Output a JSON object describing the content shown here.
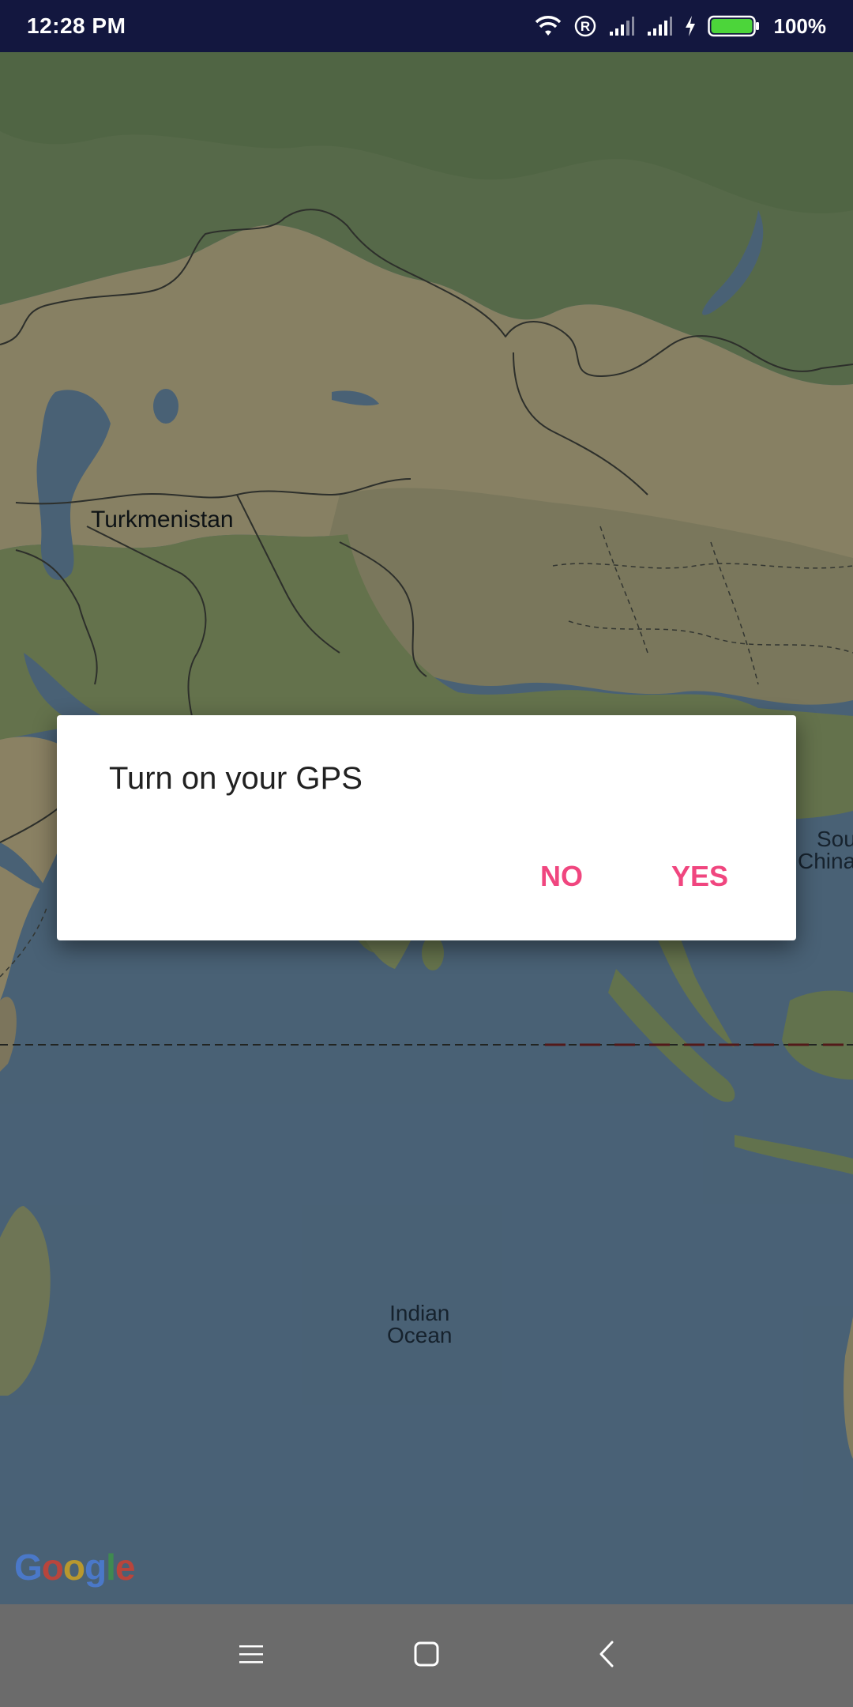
{
  "status_bar": {
    "time": "12:28 PM",
    "battery_percent": "100%",
    "icons": [
      "wifi-icon",
      "registered-icon",
      "signal-icon",
      "signal-icon",
      "charging-icon",
      "battery-icon"
    ]
  },
  "map": {
    "labels": {
      "turkmenistan": "Turkmenistan",
      "indian_ocean_line1": "Indian",
      "indian_ocean_line2": "Ocean",
      "south_china_line1": "Sou",
      "south_china_line2": "China"
    },
    "attribution": {
      "letters": [
        "G",
        "o",
        "o",
        "g",
        "l",
        "e"
      ],
      "colors": [
        "#4285F4",
        "#EA4335",
        "#FBBC05",
        "#4285F4",
        "#34A853",
        "#EA4335"
      ]
    }
  },
  "dialog": {
    "message": "Turn on your GPS",
    "negative_label": "NO",
    "positive_label": "YES",
    "accent_color": "#f0467f"
  },
  "nav_bar": {
    "icons": [
      "menu-icon",
      "home-icon",
      "back-icon"
    ]
  }
}
